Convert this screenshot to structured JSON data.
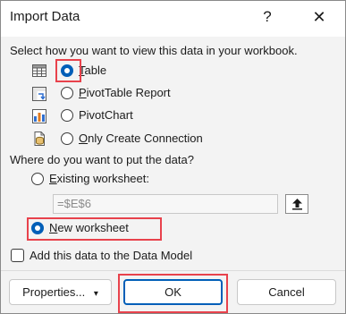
{
  "dialog": {
    "title": "Import Data",
    "help_glyph": "?",
    "close_glyph": "✕"
  },
  "view_section": {
    "prompt": "Select how you want to view this data in your workbook.",
    "options": [
      {
        "label": "Table",
        "mnemonic": "T",
        "rest": "able",
        "selected": true,
        "icon": "table-icon"
      },
      {
        "label": "PivotTable Report",
        "mnemonic": "P",
        "rest": "ivotTable Report",
        "selected": false,
        "icon": "pivottable-icon"
      },
      {
        "label": "PivotChart",
        "mnemonic": "",
        "rest": "PivotChart",
        "selected": false,
        "icon": "pivotchart-icon"
      },
      {
        "label": "Only Create Connection",
        "mnemonic": "O",
        "rest": "nly Create Connection",
        "selected": false,
        "icon": "connection-icon"
      }
    ]
  },
  "location_section": {
    "prompt": "Where do you want to put the data?",
    "existing": {
      "label": "Existing worksheet:",
      "mnemonic": "E",
      "rest": "xisting worksheet:",
      "selected": false
    },
    "range_value": "=$E$6",
    "new": {
      "label": "New worksheet",
      "mnemonic": "N",
      "rest": "ew worksheet",
      "selected": true
    }
  },
  "data_model": {
    "label": "Add this data to the Data Model",
    "checked": false
  },
  "buttons": {
    "properties": "Properties...",
    "properties_arrow": "▾",
    "ok": "OK",
    "cancel": "Cancel"
  },
  "colors": {
    "accent": "#005fb8",
    "highlight": "#e8424c"
  }
}
